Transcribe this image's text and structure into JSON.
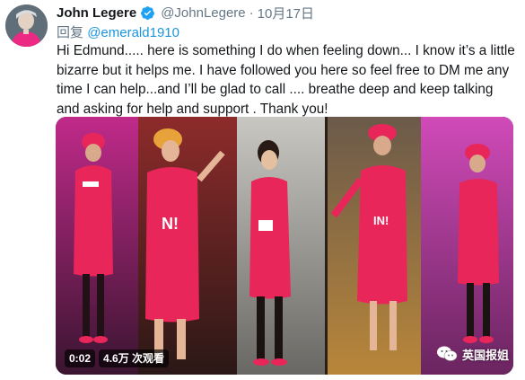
{
  "tweet": {
    "author_name": "John Legere",
    "handle": "@JohnLegere",
    "separator": "·",
    "date": "10月17日",
    "reply_prefix": "回复",
    "reply_to": "@emerald1910",
    "text": "Hi Edmund..... here is something I do when feeling down... I know it’s a little bizarre but it helps me. I have followed you here so feel free to DM me any time I can help...and I’ll be glad to call .... breathe deep and keep talking and asking for help and support . Thank you!"
  },
  "video": {
    "duration": "0:02",
    "views": "4.6万 次观看"
  },
  "watermark": {
    "label": "英国报姐"
  },
  "colors": {
    "link": "#1b95e0",
    "secondary_text": "#657786",
    "verified": "#1da1f2",
    "apron": "#e8265a"
  },
  "icons": {
    "verified": "verified-badge-icon",
    "watermark": "wechat-icon"
  }
}
